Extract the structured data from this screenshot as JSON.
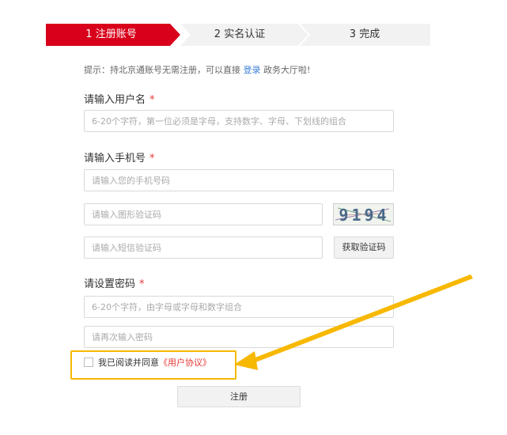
{
  "steps": [
    {
      "label": "1 注册账号",
      "active": true
    },
    {
      "label": "2 实名认证",
      "active": false
    },
    {
      "label": "3 完成",
      "active": false
    }
  ],
  "hint": {
    "text": "提示：持北京通账号无需注册，可以直接",
    "link": "登录",
    "suffix": "政务大厅啦!"
  },
  "form": {
    "username": {
      "label": "请输入用户名",
      "required_mark": "*",
      "placeholder": "6-20个字符，第一位必须是字母，支持数字、字母、下划线的组合"
    },
    "phone": {
      "label": "请输入手机号",
      "required_mark": "*",
      "placeholder": "请输入您的手机号码"
    },
    "image_code": {
      "placeholder": "请输入图形验证码",
      "captcha_text": "9194"
    },
    "sms_code": {
      "placeholder": "请输入短信验证码",
      "button": "获取验证码"
    },
    "password": {
      "label": "请设置密码",
      "required_mark": "*",
      "placeholder": "6-20个字符，由字母或字母和数字组合"
    },
    "password_confirm": {
      "placeholder": "请再次输入密码"
    },
    "agree": {
      "text": "我已阅读并同意",
      "link": "《用户协议》",
      "checked": false
    },
    "submit": "注册"
  },
  "colors": {
    "active_step": "#d9001b",
    "inactive_step": "#f2f2f2",
    "link": "#3b7fd9",
    "required": "#e53935",
    "highlight": "#f7b800"
  }
}
